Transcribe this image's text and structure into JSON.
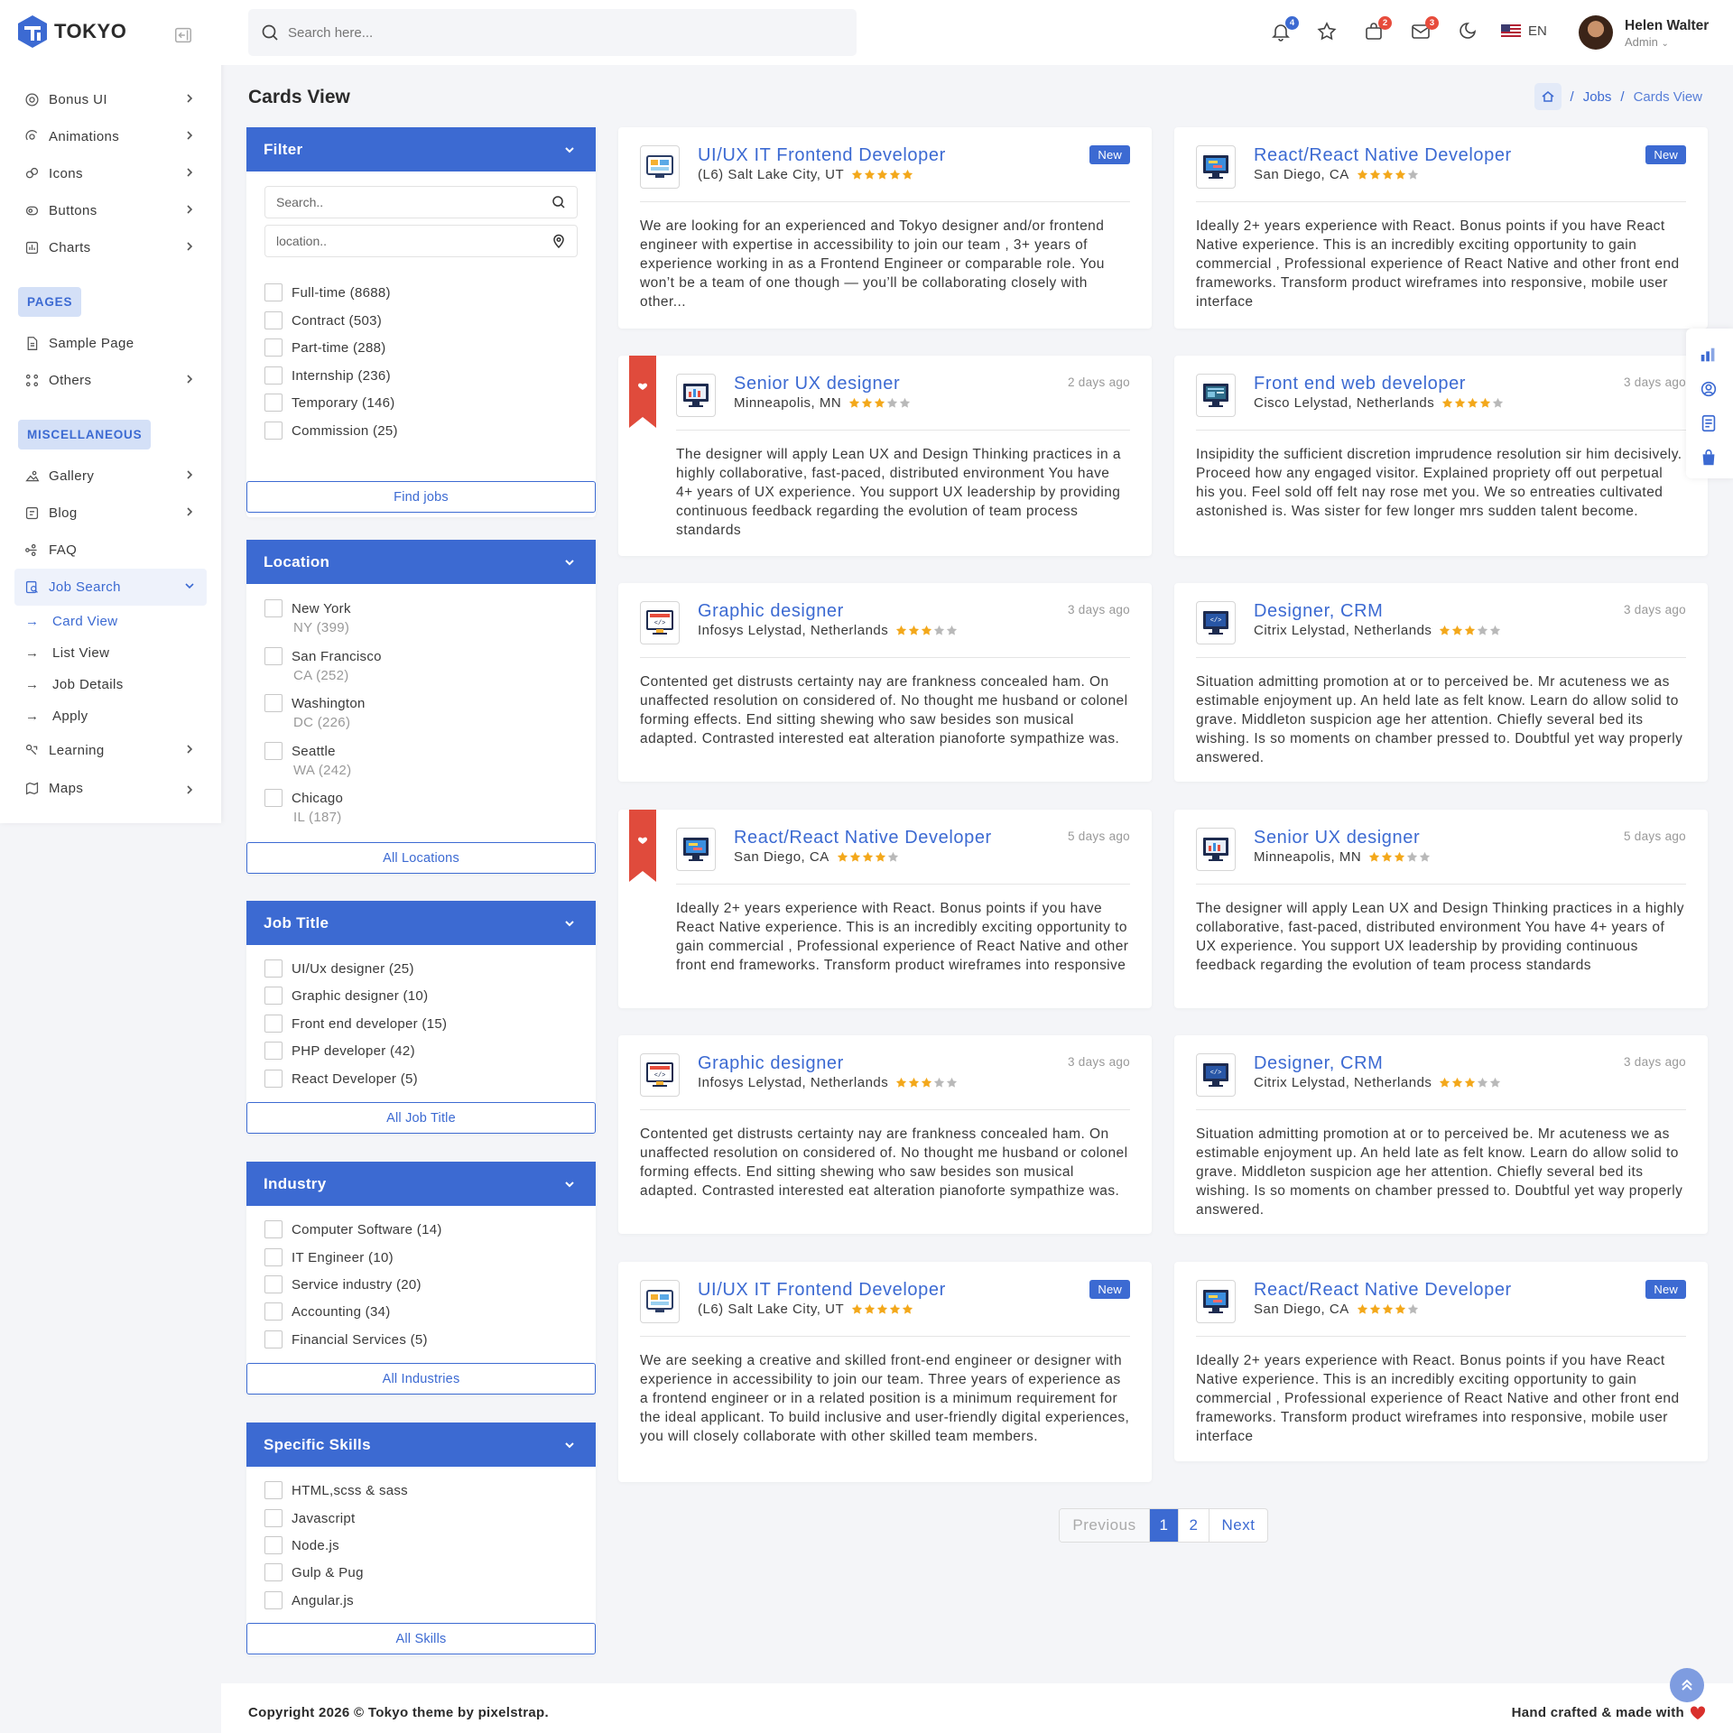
{
  "app": {
    "name": "TOKYO",
    "brand_color": "#3c6ad2"
  },
  "sidebar": {
    "items_top": [
      {
        "label": "Bonus UI",
        "icon": "bonus-icon"
      },
      {
        "label": "Animations",
        "icon": "animation-icon"
      },
      {
        "label": "Icons",
        "icon": "icons-icon"
      },
      {
        "label": "Buttons",
        "icon": "buttons-icon"
      },
      {
        "label": "Charts",
        "icon": "charts-icon"
      }
    ],
    "section_pages": "PAGES",
    "items_pages": [
      {
        "label": "Sample Page",
        "icon": "page-icon"
      },
      {
        "label": "Others",
        "icon": "others-icon"
      }
    ],
    "section_misc": "MISCELLANEOUS",
    "items_misc": [
      {
        "label": "Gallery",
        "icon": "gallery-icon"
      },
      {
        "label": "Blog",
        "icon": "blog-icon"
      },
      {
        "label": "FAQ",
        "icon": "faq-icon"
      },
      {
        "label": "Job Search",
        "icon": "job-search-icon"
      }
    ],
    "job_search_sub": [
      "Card View",
      "List View",
      "Job Details",
      "Apply"
    ],
    "items_bottom": [
      {
        "label": "Learning",
        "icon": "learning-icon"
      },
      {
        "label": "Maps",
        "icon": "maps-icon"
      }
    ]
  },
  "header": {
    "search_placeholder": "Search here...",
    "notification_count": "4",
    "cart_count": "2",
    "message_count": "3",
    "language": "EN",
    "user_name": "Helen Walter",
    "user_role": "Admin"
  },
  "page": {
    "title": "Cards View",
    "breadcrumb": [
      "Jobs",
      "Cards View"
    ]
  },
  "filters": {
    "filter": {
      "title": "Filter",
      "search_placeholder": "Search..",
      "location_placeholder": "location..",
      "options": [
        "Full-time (8688)",
        "Contract (503)",
        "Part-time (288)",
        "Internship (236)",
        "Temporary (146)",
        "Commission (25)"
      ],
      "button": "Find jobs"
    },
    "location": {
      "title": "Location",
      "options": [
        {
          "city": "New York",
          "sub": "NY (399)"
        },
        {
          "city": "San Francisco",
          "sub": "CA (252)"
        },
        {
          "city": "Washington",
          "sub": "DC (226)"
        },
        {
          "city": "Seattle",
          "sub": "WA (242)"
        },
        {
          "city": "Chicago",
          "sub": "IL (187)"
        }
      ],
      "button": "All Locations"
    },
    "job_title": {
      "title": "Job Title",
      "options": [
        "UI/Ux designer (25)",
        "Graphic designer (10)",
        "Front end developer (15)",
        "PHP developer (42)",
        "React Developer (5)"
      ],
      "button": "All Job Title"
    },
    "industry": {
      "title": "Industry",
      "options": [
        "Computer Software (14)",
        "IT Engineer (10)",
        "Service industry (20)",
        "Accounting (34)",
        "Financial Services (5)"
      ],
      "button": "All Industries"
    },
    "skills": {
      "title": "Specific Skills",
      "options": [
        "HTML,scss & sass",
        "Javascript",
        "Node.js",
        "Gulp & Pug",
        "Angular.js"
      ],
      "button": "All Skills"
    }
  },
  "jobs": [
    {
      "title": "UI/UX IT Frontend Developer",
      "location": "(L6) Salt Lake City, UT",
      "rating": 5,
      "tag": "New",
      "ribbon": false,
      "icon": "job-board-icon",
      "description": "We are looking for an experienced and Tokyo designer and/or frontend engineer with expertise in accessibility to join our team , 3+ years of experience working in as a Frontend Engineer or comparable role. You won’t be a team of one though — you’ll be collaborating closely with other..."
    },
    {
      "title": "React/React Native Developer",
      "location": "San Diego, CA",
      "rating": 4,
      "tag": "New",
      "ribbon": false,
      "icon": "monitor-code-icon",
      "description": "Ideally 2+ years experience with React. Bonus points if you have React Native experience. This is an incredibly exciting opportunity to gain commercial , Professional experience of React Native and other front end frameworks. Transform product wireframes into responsive, mobile user interface"
    },
    {
      "title": "Senior UX designer",
      "location": "Minneapolis, MN",
      "rating": 3,
      "tag": "2 days ago",
      "ribbon": true,
      "icon": "monitor-chart-icon",
      "description": "The designer will apply Lean UX and Design Thinking practices in a highly collaborative, fast-paced, distributed environment You have 4+ years of UX experience. You support UX leadership by providing continuous feedback regarding the evolution of team process standards"
    },
    {
      "title": "Front end web developer",
      "location": "Cisco Lelystad, Netherlands",
      "rating": 4,
      "tag": "3 days ago",
      "ribbon": false,
      "icon": "monitor-web-icon",
      "description": "Insipidity the sufficient discretion imprudence resolution sir him decisively. Proceed how any engaged visitor. Explained propriety off out perpetual his you. Feel sold off felt nay rose met you. We so entreaties cultivated astonished is. Was sister for few longer mrs sudden talent become."
    },
    {
      "title": "Graphic designer",
      "location": "Infosys Lelystad, Netherlands",
      "rating": 3,
      "tag": "3 days ago",
      "ribbon": false,
      "icon": "monitor-design-icon",
      "description": "Contented get distrusts certainty nay are frankness concealed ham. On unaffected resolution on considered of. No thought me husband or colonel forming effects. End sitting shewing who saw besides son musical adapted. Contrasted interested eat alteration pianoforte sympathize was."
    },
    {
      "title": "Designer, CRM",
      "location": "Citrix Lelystad, Netherlands",
      "rating": 3,
      "tag": "3 days ago",
      "ribbon": false,
      "icon": "monitor-crm-icon",
      "description": "Situation admitting promotion at or to perceived be. Mr acuteness we as estimable enjoyment up. An held late as felt know. Learn do allow solid to grave. Middleton suspicion age her attention. Chiefly several bed its wishing. Is so moments on chamber pressed to. Doubtful yet way properly answered."
    },
    {
      "title": "React/React Native Developer",
      "location": "San Diego, CA",
      "rating": 4,
      "tag": "5 days ago",
      "ribbon": true,
      "icon": "monitor-code-icon",
      "description": "Ideally 2+ years experience with React. Bonus points if you have React Native experience. This is an incredibly exciting opportunity to gain commercial , Professional experience of React Native and other front end frameworks. Transform product wireframes into responsive"
    },
    {
      "title": "Senior UX designer",
      "location": "Minneapolis, MN",
      "rating": 3,
      "tag": "5 days ago",
      "ribbon": false,
      "icon": "monitor-chart-icon",
      "description": "The designer will apply Lean UX and Design Thinking practices in a highly collaborative, fast-paced, distributed environment You have 4+ years of UX experience. You support UX leadership by providing continuous feedback regarding the evolution of team process standards"
    },
    {
      "title": "Graphic designer",
      "location": "Infosys Lelystad, Netherlands",
      "rating": 3,
      "tag": "3 days ago",
      "ribbon": false,
      "icon": "monitor-design-icon",
      "description": "Contented get distrusts certainty nay are frankness concealed ham. On unaffected resolution on considered of. No thought me husband or colonel forming effects. End sitting shewing who saw besides son musical adapted. Contrasted interested eat alteration pianoforte sympathize was."
    },
    {
      "title": "Designer, CRM",
      "location": "Citrix Lelystad, Netherlands",
      "rating": 3,
      "tag": "3 days ago",
      "ribbon": false,
      "icon": "monitor-crm-icon",
      "description": "Situation admitting promotion at or to perceived be. Mr acuteness we as estimable enjoyment up. An held late as felt know. Learn do allow solid to grave. Middleton suspicion age her attention. Chiefly several bed its wishing. Is so moments on chamber pressed to. Doubtful yet way properly answered."
    },
    {
      "title": "UI/UX IT Frontend Developer",
      "location": "(L6) Salt Lake City, UT",
      "rating": 5,
      "tag": "New",
      "ribbon": false,
      "icon": "job-board-icon",
      "description": "We are seeking a creative and skilled front-end engineer or designer with experience in accessibility to join our team. Three years of experience as a frontend engineer or in a related position is a minimum requirement for the ideal applicant. To build inclusive and user-friendly digital experiences, you will closely collaborate with other skilled team members."
    },
    {
      "title": "React/React Native Developer",
      "location": "San Diego, CA",
      "rating": 4,
      "tag": "New",
      "ribbon": false,
      "icon": "monitor-code-icon",
      "description": "Ideally 2+ years experience with React. Bonus points if you have React Native experience. This is an incredibly exciting opportunity to gain commercial , Professional experience of React Native and other front end frameworks. Transform product wireframes into responsive, mobile user interface"
    }
  ],
  "pagination": {
    "previous": "Previous",
    "pages": [
      "1",
      "2"
    ],
    "current": "1",
    "next": "Next"
  },
  "footer": {
    "left": "Copyright 2026 © Tokyo theme by pixelstrap.",
    "right": "Hand crafted & made with"
  }
}
